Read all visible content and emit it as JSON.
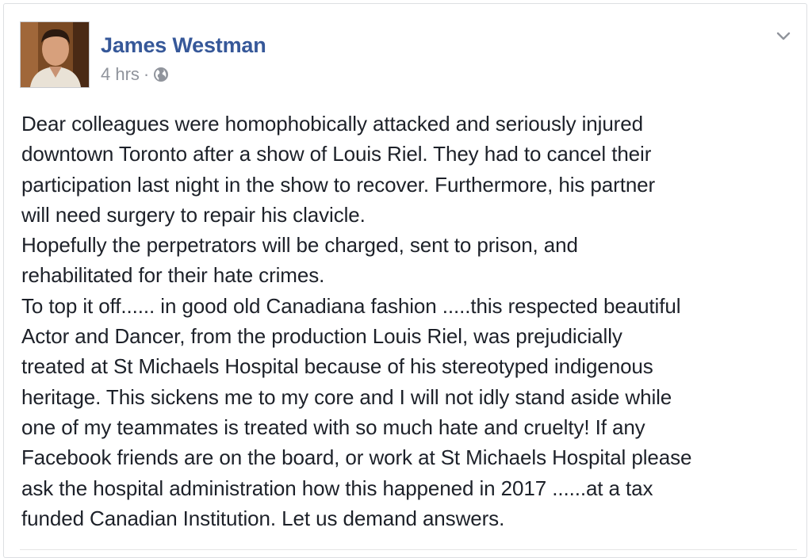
{
  "post": {
    "author": "James Westman",
    "timestamp": "4 hrs",
    "separator": "·",
    "privacy_icon": "globe-icon",
    "menu_icon": "chevron-down-icon",
    "body_lines": [
      "Dear colleagues were homophobically attacked and seriously injured",
      "downtown Toronto after a show of Louis Riel. They had to cancel their",
      "participation last night in the show to recover. Furthermore, his partner",
      "will need surgery to repair his clavicle.",
      "Hopefully the perpetrators will be charged, sent to prison, and",
      "rehabilitated for their hate crimes.",
      "To top it off...... in good old Canadiana fashion .....this respected beautiful",
      "Actor and Dancer, from the production Louis Riel, was prejudicially",
      "treated at St Michaels Hospital because of his stereotyped indigenous",
      "heritage. This sickens me to my core and I will not idly stand aside while",
      "one of my teammates is treated with so much hate and cruelty! If any",
      "Facebook friends are on the board, or work at St Michaels Hospital please",
      "ask the hospital administration how this happened in 2017 ......at a tax",
      "funded Canadian Institution. Let us demand answers."
    ]
  },
  "colors": {
    "author_link": "#365899",
    "meta_text": "#90949c",
    "body_text": "#1d2129",
    "card_border": "#dddfe2"
  }
}
